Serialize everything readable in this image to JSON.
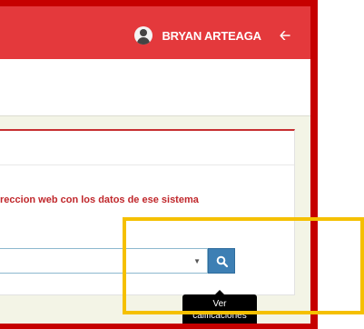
{
  "header": {
    "user_name": "BRYAN ARTEAGA",
    "back_icon": "arrow-left-icon",
    "avatar_icon": "user-avatar-icon"
  },
  "main": {
    "instruction_text": "reccion web con los datos de ese sistema",
    "select_value": "",
    "select_caret_icon": "caret-down-icon",
    "search_button_icon": "search-icon",
    "tooltip_line1": "Ver",
    "tooltip_line2": "calificaciones"
  },
  "colors": {
    "header_bar": "#e4393c",
    "frame_border": "#c60000",
    "highlight_border": "#f5c000",
    "button": "#3d7fb4",
    "instruction_text": "#c0272b"
  }
}
